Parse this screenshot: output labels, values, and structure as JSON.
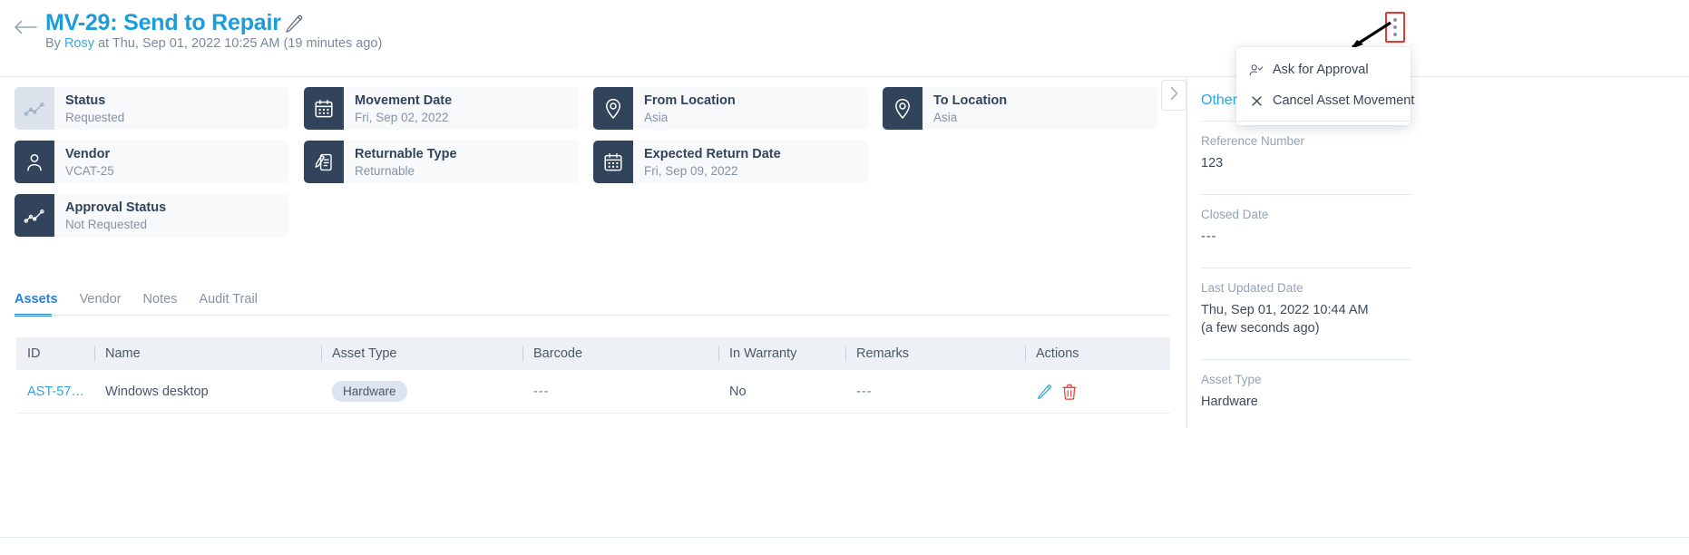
{
  "header": {
    "back_icon": "arrow-left-icon",
    "title": "MV-29: Send to Repair",
    "edit_icon": "pencil-icon",
    "byline_prefix": "By ",
    "byline_user": "Rosy",
    "byline_suffix": " at Thu, Sep 01, 2022 10:25 AM (19 minutes ago)",
    "kebab_icon": "more-vertical-icon",
    "highlight_color": "#e8392e",
    "accent_color": "#1b9dd9"
  },
  "dropdown": {
    "items": [
      {
        "label": "Ask for Approval",
        "icon": "user-check-icon"
      },
      {
        "label": "Cancel Asset Movement",
        "icon": "close-x-icon"
      }
    ]
  },
  "cards": [
    {
      "label": "Status",
      "value": "Requested",
      "icon": "line-chart-icon",
      "style": "light"
    },
    {
      "label": "Movement Date",
      "value": "Fri, Sep 02, 2022",
      "icon": "calendar-icon",
      "style": "dark"
    },
    {
      "label": "From Location",
      "value": "Asia",
      "icon": "map-pin-icon",
      "style": "dark"
    },
    {
      "label": "To Location",
      "value": "Asia",
      "icon": "map-pin-icon",
      "style": "dark"
    },
    {
      "label": "Vendor",
      "value": "VCAT-25",
      "icon": "user-icon",
      "style": "dark"
    },
    {
      "label": "Returnable Type",
      "value": "Returnable",
      "icon": "document-pen-icon",
      "style": "dark"
    },
    {
      "label": "Expected Return Date",
      "value": "Fri, Sep 09, 2022",
      "icon": "calendar-icon",
      "style": "dark"
    },
    {
      "label": "Approval Status",
      "value": "Not Requested",
      "icon": "line-chart-icon",
      "style": "dark"
    }
  ],
  "tabs": [
    {
      "label": "Assets",
      "active": true
    },
    {
      "label": "Vendor",
      "active": false
    },
    {
      "label": "Notes",
      "active": false
    },
    {
      "label": "Audit Trail",
      "active": false
    }
  ],
  "table": {
    "columns": [
      "ID",
      "Name",
      "Asset Type",
      "Barcode",
      "In Warranty",
      "Remarks",
      "Actions"
    ],
    "rows": [
      {
        "id": "AST-57…",
        "name": "Windows desktop",
        "asset_type": "Hardware",
        "barcode": "---",
        "in_warranty": "No",
        "remarks": "---",
        "actions": [
          "edit-icon",
          "delete-icon"
        ]
      }
    ]
  },
  "side_panel": {
    "collapse_icon": "chevron-right-icon",
    "title": "Other",
    "fields": [
      {
        "label": "Reference Number",
        "value": "123"
      },
      {
        "label": "Closed Date",
        "value": "---"
      },
      {
        "label": "Last Updated Date",
        "value": "Thu, Sep 01, 2022 10:44 AM\n(a few seconds ago)"
      },
      {
        "label": "Asset Type",
        "value": "Hardware"
      }
    ]
  }
}
